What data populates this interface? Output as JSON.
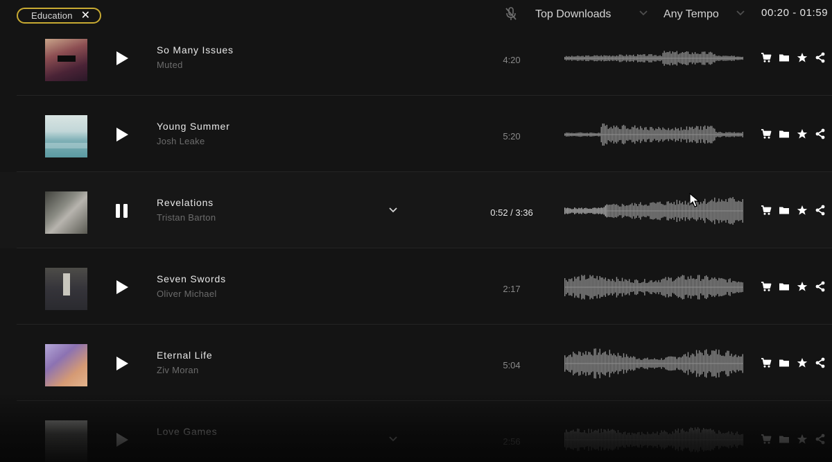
{
  "filters": {
    "tag": {
      "label": "Education",
      "close_icon": "close-icon"
    },
    "mic_icon": "microphone-off-icon",
    "sort": {
      "selected": "Top Downloads"
    },
    "tempo": {
      "selected": "Any Tempo"
    },
    "duration_range": "00:20 - 01:59"
  },
  "tracks": [
    {
      "title": "So Many Issues",
      "artist": "Muted",
      "duration": "4:20",
      "state": "paused",
      "waveform_profile": "low"
    },
    {
      "title": "Young Summer",
      "artist": "Josh Leake",
      "duration": "5:20",
      "state": "paused",
      "waveform_profile": "mid"
    },
    {
      "title": "Revelations",
      "artist": "Tristan Barton",
      "duration": "0:52 / 3:36",
      "state": "playing",
      "waveform_profile": "rising"
    },
    {
      "title": "Seven Swords",
      "artist": "Oliver Michael",
      "duration": "2:17",
      "state": "paused",
      "waveform_profile": "full"
    },
    {
      "title": "Eternal Life",
      "artist": "Ziv Moran",
      "duration": "5:04",
      "state": "paused",
      "waveform_profile": "wave"
    },
    {
      "title": "Love Games",
      "artist": "",
      "duration": "2:56",
      "state": "paused",
      "waveform_profile": "full"
    }
  ],
  "row_actions": [
    "cart-icon",
    "folder-icon",
    "star-icon",
    "share-icon"
  ],
  "colors": {
    "background": "#141414",
    "chip_border": "#c8aa32",
    "waveform": "#8e8e8e",
    "waveform_played": "#b4b4b4"
  }
}
